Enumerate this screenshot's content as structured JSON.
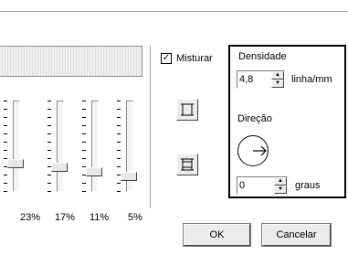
{
  "sliders": {
    "items": [
      {
        "label": "23%",
        "level": 0.23
      },
      {
        "label": "17%",
        "level": 0.17
      },
      {
        "label": "11%",
        "level": 0.11
      },
      {
        "label": "5%",
        "level": 0.05
      }
    ]
  },
  "mix": {
    "label": "Misturar",
    "checked": true
  },
  "density": {
    "title": "Densidade",
    "value": "4,8",
    "unit": "linha/mm"
  },
  "direction": {
    "title": "Direção",
    "value": "0",
    "unit": "graus"
  },
  "buttons": {
    "ok": "OK",
    "cancel": "Cancelar"
  }
}
